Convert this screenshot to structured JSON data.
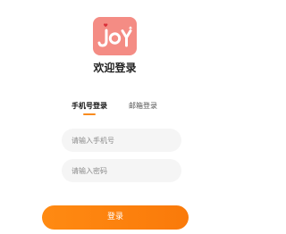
{
  "app": {
    "logo_text": "JOY",
    "logo_color": "#f48c84",
    "accent_color": "#f98b1e"
  },
  "header": {
    "title": "欢迎登录"
  },
  "tabs": [
    {
      "label": "手机号登录",
      "active": true
    },
    {
      "label": "邮箱登录",
      "active": false
    }
  ],
  "form": {
    "phone_placeholder": "请输入手机号",
    "password_placeholder": "请输入密码",
    "login_label": "登录"
  }
}
